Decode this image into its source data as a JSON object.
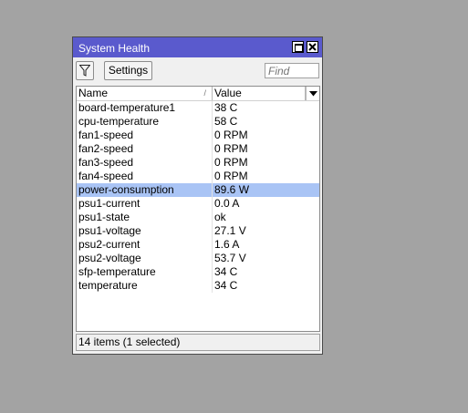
{
  "window": {
    "title": "System Health"
  },
  "toolbar": {
    "filter_icon": "filter-icon",
    "settings_label": "Settings",
    "find_placeholder": "Find"
  },
  "table": {
    "columns": [
      "Name",
      "Value"
    ],
    "rows": [
      {
        "name": "board-temperature1",
        "value": "38 C",
        "selected": false
      },
      {
        "name": "cpu-temperature",
        "value": "58 C",
        "selected": false
      },
      {
        "name": "fan1-speed",
        "value": "0 RPM",
        "selected": false
      },
      {
        "name": "fan2-speed",
        "value": "0 RPM",
        "selected": false
      },
      {
        "name": "fan3-speed",
        "value": "0 RPM",
        "selected": false
      },
      {
        "name": "fan4-speed",
        "value": "0 RPM",
        "selected": false
      },
      {
        "name": "power-consumption",
        "value": "89.6 W",
        "selected": true
      },
      {
        "name": "psu1-current",
        "value": "0.0 A",
        "selected": false
      },
      {
        "name": "psu1-state",
        "value": "ok",
        "selected": false
      },
      {
        "name": "psu1-voltage",
        "value": "27.1 V",
        "selected": false
      },
      {
        "name": "psu2-current",
        "value": "1.6 A",
        "selected": false
      },
      {
        "name": "psu2-voltage",
        "value": "53.7 V",
        "selected": false
      },
      {
        "name": "sfp-temperature",
        "value": "34 C",
        "selected": false
      },
      {
        "name": "temperature",
        "value": "34 C",
        "selected": false
      }
    ]
  },
  "status": {
    "text": "14 items (1 selected)"
  },
  "colors": {
    "titlebar": "#5a5acd",
    "selected_row": "#a9c4f5",
    "desktop": "#a3a3a3"
  }
}
